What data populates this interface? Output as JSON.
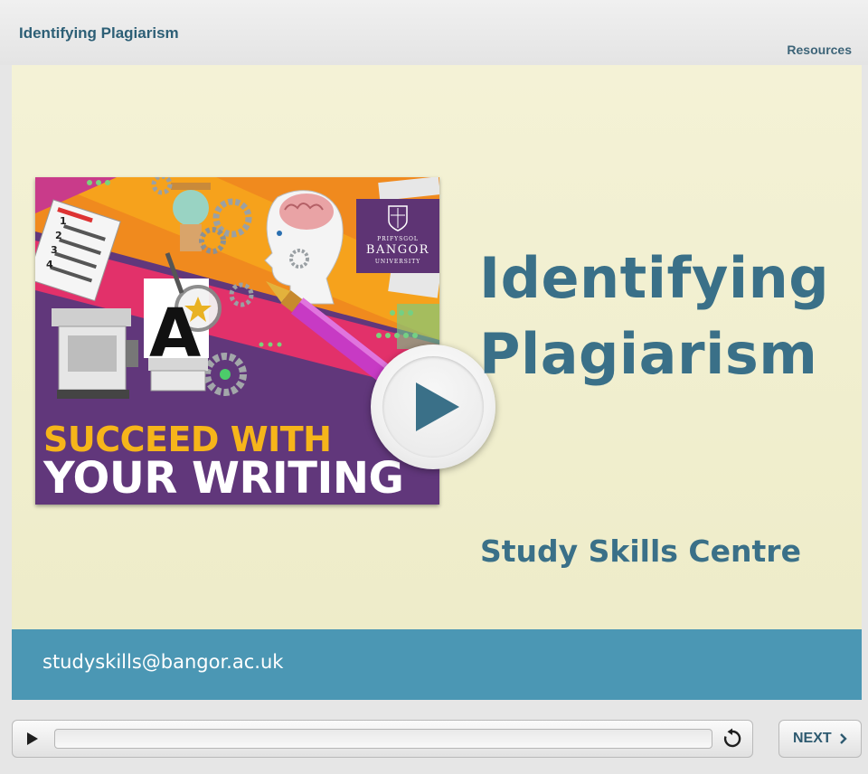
{
  "header": {
    "course_title": "Identifying Plagiarism",
    "resources_label": "Resources"
  },
  "slide": {
    "title_line1": "Identifying",
    "title_line2": "Plagiarism",
    "subtitle": "Study Skills Centre",
    "cover": {
      "line1": "SUCCEED WITH",
      "line2": "YOUR WRITING",
      "logo_small": "PRIFYSGOL",
      "logo_name": "BANGOR",
      "logo_sub": "UNIVERSITY",
      "letter": "A",
      "list_numbers": [
        "1",
        "2",
        "3",
        "4"
      ]
    },
    "footer_email": "studyskills@bangor.ac.uk"
  },
  "player": {
    "progress": 0,
    "next_label": "NEXT"
  },
  "colors": {
    "title_teal": "#3a7088",
    "band_blue": "#4b97b4",
    "slide_bg": "#f4f2d6",
    "cover_purple": "#61377b",
    "cover_yellow": "#f6b51a"
  },
  "icons": {
    "play": "play-icon",
    "replay": "replay-icon",
    "next": "chevron-right-icon"
  }
}
